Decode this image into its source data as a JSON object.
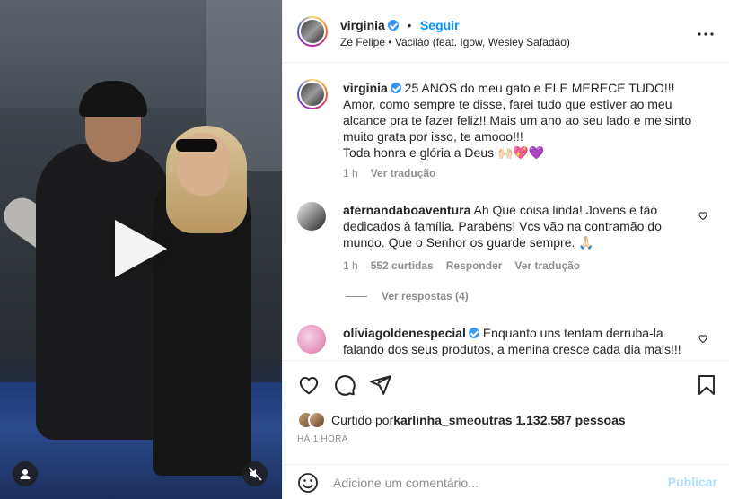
{
  "header": {
    "username": "virginia",
    "separator": "•",
    "follow_label": "Seguir",
    "audio": "Zé Felipe • Vacilão (feat. Igow, Wesley Safadão)"
  },
  "caption": {
    "username": "virginia",
    "line1": " 25 ANOS do meu gato e ELE MERECE TUDO!!!",
    "line2": "Amor, como sempre te disse, farei tudo que estiver ao meu alcance pra te fazer feliz!! Mais um ano ao seu lado e me sinto muito grata por isso, te amooo!!!",
    "line3": "Toda honra e glória a Deus 🙌🏻💖💜",
    "time": "1 h",
    "translate": "Ver tradução"
  },
  "comments": [
    {
      "username": "afernandaboaventura",
      "text": " Ah Que coisa linda! Jovens e tão dedicados à família. Parabéns! Vcs vão na contramão do mundo. Que o Senhor os guarde sempre. 🙏🏻",
      "time": "1 h",
      "likes": "552 curtidas",
      "reply": "Responder",
      "translate": "Ver tradução"
    },
    {
      "username": "oliviagoldenespecial",
      "text": " Enquanto uns tentam derruba-la falando dos seus produtos, a menina cresce cada dia mais!!!"
    }
  ],
  "view_replies": "Ver respostas (4)",
  "likes_row": {
    "prefix": "Curtido por ",
    "user": "karlinha_sm",
    "middle": " e ",
    "others": "outras 1.132.587 pessoas"
  },
  "time_ago": "HÁ 1 HORA",
  "add_comment": {
    "placeholder": "Adicione um comentário...",
    "publish": "Publicar"
  },
  "colors": {
    "accent": "#0095f6",
    "verified": "#3897f0",
    "muted": "#8e8e8e",
    "publish_disabled": "#b2dffc"
  },
  "icons": [
    "play-icon",
    "user-tag-icon",
    "muted-speaker-icon",
    "more-icon",
    "heart-icon",
    "comment-icon",
    "share-icon",
    "bookmark-icon",
    "smile-icon"
  ]
}
